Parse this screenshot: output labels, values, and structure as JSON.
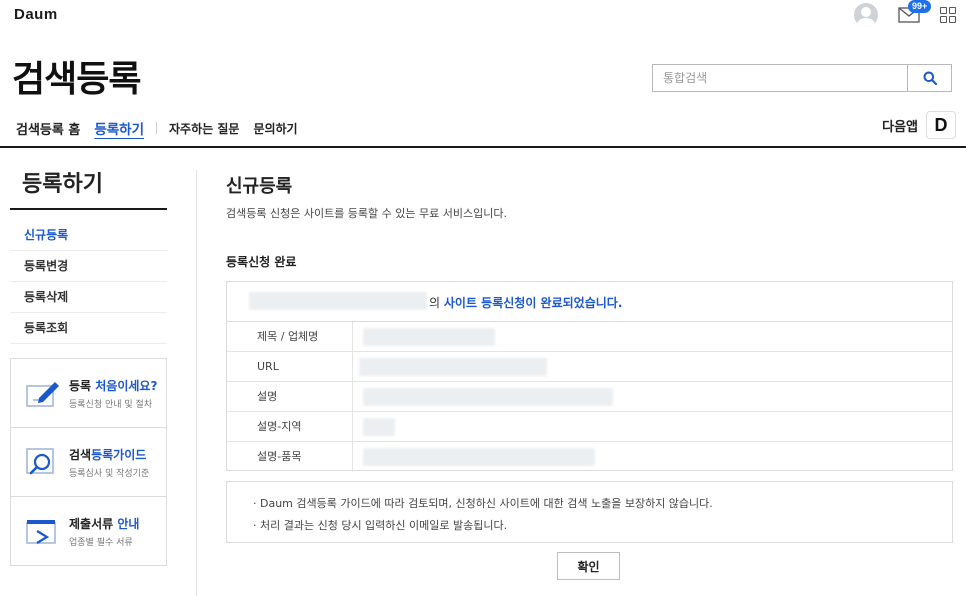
{
  "topbar": {
    "logo": "Daum",
    "mail_badge": "99+"
  },
  "header": {
    "title": "검색등록",
    "search_placeholder": "통합검색",
    "nav": {
      "home": "검색등록 홈",
      "register": "등록하기",
      "faq": "자주하는 질문",
      "contact": "문의하기"
    },
    "daum_app_label": "다음앱",
    "daum_app_icon": "D"
  },
  "sidebar": {
    "title": "등록하기",
    "items": [
      {
        "label": "신규등록",
        "active": true
      },
      {
        "label": "등록변경",
        "active": false
      },
      {
        "label": "등록삭제",
        "active": false
      },
      {
        "label": "등록조회",
        "active": false
      }
    ],
    "promos": [
      {
        "title_plain": "등록 ",
        "title_highlight": "처음이세요?",
        "sub": "등록신청 안내 및 절차",
        "icon": "pencil-icon"
      },
      {
        "title_plain": "검색",
        "title_highlight": "등록가이드",
        "sub": "등록심사 및 작성기준",
        "icon": "magnifier-icon"
      },
      {
        "title_plain": "제출서류 ",
        "title_highlight": "안내",
        "sub": "업종별 필수 서류",
        "icon": "document-icon"
      }
    ]
  },
  "main": {
    "title": "신규등록",
    "description": "검색등록 신청은 사이트를 등록할 수 있는 무료 서비스입니다.",
    "section_title": "등록신청 완료",
    "result_msg_prefix": "의 ",
    "result_msg_bold": "사이트 등록신청이 완료되었습니다.",
    "rows": [
      {
        "label": "제목 / 업체명"
      },
      {
        "label": "URL"
      },
      {
        "label": "설명"
      },
      {
        "label": "설명-지역"
      },
      {
        "label": "설명-품목"
      }
    ],
    "notices": [
      "· Daum 검색등록 가이드에 따라 검토되며, 신청하신 사이트에 대한 검색 노출을 보장하지 않습니다.",
      "· 처리 결과는 신청 당시 입력하신 이메일로 발송됩니다."
    ],
    "confirm_button": "확인"
  },
  "colors": {
    "accent": "#1b58cc",
    "badge": "#1e6fea"
  }
}
